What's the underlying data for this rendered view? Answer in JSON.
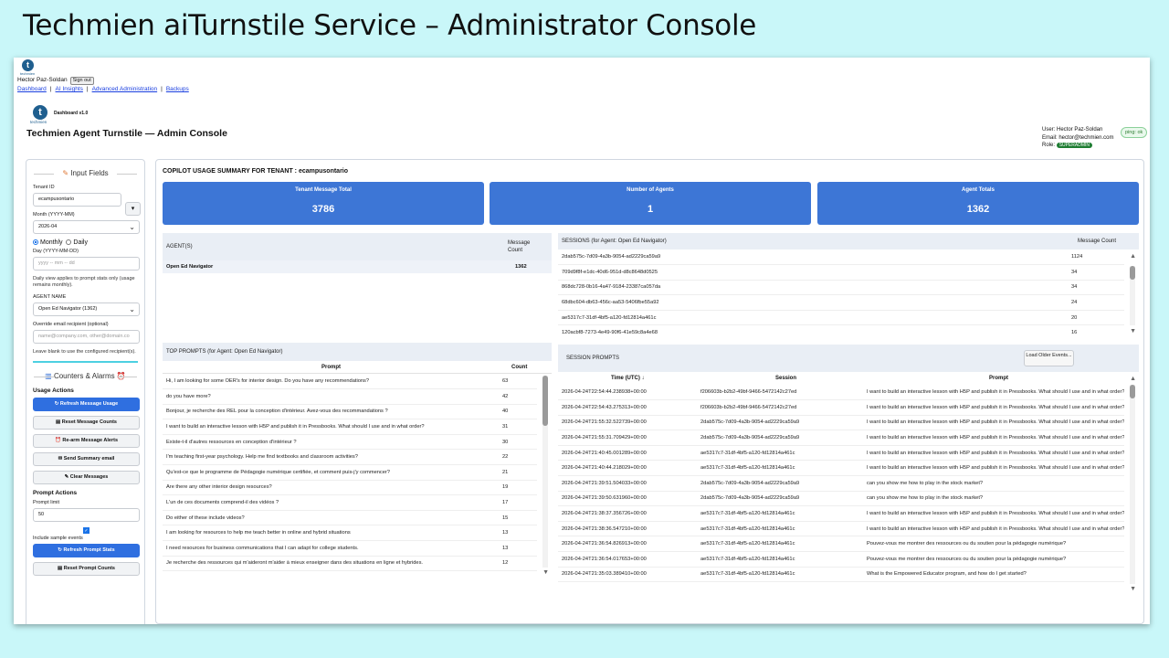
{
  "slide": {
    "title": "Techmien aiTurnstile Service – Administrator Console"
  },
  "topbar": {
    "logo_text": "techmien",
    "user_name": "Hector Paz-Soldan",
    "sign_out": "Sign out",
    "nav": [
      "Dashboard",
      "AI Insights",
      "Advanced Administration",
      "Backups"
    ]
  },
  "header": {
    "logo_text": "techmien",
    "version": "Dashboard v1.0",
    "title": "Techmien Agent Turnstile — Admin Console",
    "user": "User: Hector Paz-Soldan",
    "email": "Email: hector@techmien.com",
    "role_label": "Role:",
    "role": "SUPERADMIN",
    "ping": "ping: ok"
  },
  "sidebar": {
    "input_title": "Input Fields",
    "tenant_label": "Tenant ID",
    "tenant_value": "ecampusontario",
    "month_label": "Month (YYYY-MM)",
    "month_value": "2026-04",
    "monthly": "Monthly",
    "daily": "Daily",
    "day_label": "Day (YYYY-MM-DD)",
    "day_placeholder": "yyyy -- mm -- dd",
    "day_note": "Daily view applies to prompt stats only (usage remains monthly).",
    "agent_label": "AGENT NAME",
    "agent_value": "Open Ed Navigator (1362)",
    "email_label": "Override email recipient (optional)",
    "email_placeholder": "name@company.com, other@domain.co",
    "email_note": "Leave blank to use the configured recipient(s).",
    "counters_title": "Counters & Alarms",
    "usage_actions": "Usage Actions",
    "buttons": [
      "Refresh Message Usage",
      "Reset Message Counts",
      "Re-arm Message Alerts",
      "Send Summary email",
      "Clear Messages"
    ],
    "prompt_actions": "Prompt Actions",
    "prompt_limit_label": "Prompt limit",
    "prompt_limit_value": "50",
    "include_sample": "Include sample events",
    "prompt_buttons": [
      "Refresh Prompt Stats",
      "Reset Prompt Counts"
    ]
  },
  "main": {
    "summary_title": "COPILOT USAGE SUMMARY FOR TENANT : ecampusontario",
    "kpis": [
      {
        "label": "Tenant Message Total",
        "value": "3786"
      },
      {
        "label": "Number of Agents",
        "value": "1"
      },
      {
        "label": "Agent Totals",
        "value": "1362"
      }
    ],
    "agents": {
      "col1": "AGENT(S)",
      "col2": "Message Count",
      "rows": [
        {
          "name": "Open Ed Navigator",
          "count": "1362"
        }
      ]
    },
    "sessions": {
      "title": "SESSIONS (for Agent: Open Ed Navigator)",
      "count_header": "Message Count",
      "rows": [
        {
          "id": "2dab575c-7d09-4a3b-9054-ad2229ca59a9",
          "count": "1124"
        },
        {
          "id": "709d9f8f-e1dc-40d6-951d-d8c8648d0525",
          "count": "34"
        },
        {
          "id": "868dc728-0b16-4a47-9184-23387ca057da",
          "count": "34"
        },
        {
          "id": "68dbc604-db63-456c-aa53-5406fbe55a92",
          "count": "24"
        },
        {
          "id": "ae5317c7-31df-4bf5-a120-fd12814a461c",
          "count": "20"
        },
        {
          "id": "120acbf8-7273-4e49-90f6-41e59c8a4e68",
          "count": "16"
        }
      ]
    },
    "top_prompts": {
      "title": "TOP PROMPTS (for Agent: Open Ed Navigator)",
      "col_prompt": "Prompt",
      "col_count": "Count",
      "rows": [
        {
          "p": "Hi, I am looking for some OER's for interior design. Do you have any recommendations?",
          "c": "63"
        },
        {
          "p": "do you have more?",
          "c": "42"
        },
        {
          "p": "Bonjour, je recherche des REL pour la conception d'intérieur. Avez-vous des recommandations ?",
          "c": "40"
        },
        {
          "p": "I want to build an interactive lesson with H5P and publish it in Pressbooks. What should I use and in what order?",
          "c": "31"
        },
        {
          "p": "Existe-t-il d'autres ressources en conception d'intérieur ?",
          "c": "30"
        },
        {
          "p": "I'm teaching first-year psychology. Help me find textbooks and classroom activities?",
          "c": "22"
        },
        {
          "p": "Qu'est-ce que le programme de Pédagogie numérique certifiée, et comment puis-j'y commencer?",
          "c": "21"
        },
        {
          "p": "Are there any other interior design resources?",
          "c": "19"
        },
        {
          "p": "L'un de ces documents comprend-il des vidéos ?",
          "c": "17"
        },
        {
          "p": "Do either of these include videos?",
          "c": "15"
        },
        {
          "p": "I am looking for resources to help me teach better in online and hybrid situations",
          "c": "13"
        },
        {
          "p": "I need resources for business communications that I can adapt for college students.",
          "c": "13"
        },
        {
          "p": "Je recherche des ressources qui m'aideront m'aider à mieux enseigner dans des situations en ligne et hybrides.",
          "c": "12"
        }
      ]
    },
    "session_prompts": {
      "title": "SESSION PROMPTS",
      "load_older": "Load Older Events...",
      "col_time": "Time (UTC) ↓",
      "col_session": "Session",
      "col_prompt": "Prompt",
      "rows": [
        {
          "t": "2026-04-24T22:54:44.238938+00:00",
          "s": "f206603b-b2b2-49bf-9466-5472142c27ed",
          "p": "I want to build an interactive lesson with H5P and publish it in Pressbooks. What should I use and in what order?"
        },
        {
          "t": "2026-04-24T22:54:43.275313+00:00",
          "s": "f206603b-b2b2-49bf-9466-5472142c27ed",
          "p": "I want to build an interactive lesson with H5P and publish it in Pressbooks. What should I use and in what order?"
        },
        {
          "t": "2026-04-24T21:55:32.522739+00:00",
          "s": "2dab575c-7d09-4a3b-9054-ad2229ca59a9",
          "p": "I want to build an interactive lesson with H5P and publish it in Pressbooks. What should I use and in what order?"
        },
        {
          "t": "2026-04-24T21:55:31.709429+00:00",
          "s": "2dab575c-7d09-4a3b-9054-ad2229ca59a9",
          "p": "I want to build an interactive lesson with H5P and publish it in Pressbooks. What should I use and in what order?"
        },
        {
          "t": "2026-04-24T21:40:45.001289+00:00",
          "s": "ae5317c7-31df-4bf5-a120-fd12814a461c",
          "p": "I want to build an interactive lesson with H5P and publish it in Pressbooks. What should I use and in what order?"
        },
        {
          "t": "2026-04-24T21:40:44.218029+00:00",
          "s": "ae5317c7-31df-4bf5-a120-fd12814a461c",
          "p": "I want to build an interactive lesson with H5P and publish it in Pressbooks. What should I use and in what order?"
        },
        {
          "t": "2026-04-24T21:39:51.504033+00:00",
          "s": "2dab575c-7d09-4a3b-9054-ad2229ca59a9",
          "p": "can you show me how to play in the stock market?"
        },
        {
          "t": "2026-04-24T21:39:50.631960+00:00",
          "s": "2dab575c-7d09-4a3b-9054-ad2229ca59a9",
          "p": "can you show me how to play in the stock market?"
        },
        {
          "t": "2026-04-24T21:38:37.356726+00:00",
          "s": "ae5317c7-31df-4bf5-a120-fd12814a461c",
          "p": "I want to build an interactive lesson with H5P and publish it in Pressbooks. What should I use and in what order?"
        },
        {
          "t": "2026-04-24T21:38:36.547210+00:00",
          "s": "ae5317c7-31df-4bf5-a120-fd12814a461c",
          "p": "I want to build an interactive lesson with H5P and publish it in Pressbooks. What should I use and in what order?"
        },
        {
          "t": "2026-04-24T21:36:54.826913+00:00",
          "s": "ae5317c7-31df-4bf5-a120-fd12814a461c",
          "p": "Pouvez-vous me montrer des ressources ou du soutien pour la pédagogie numérique?"
        },
        {
          "t": "2026-04-24T21:36:54.017653+00:00",
          "s": "ae5317c7-31df-4bf5-a120-fd12814a461c",
          "p": "Pouvez-vous me montrer des ressources ou du soutien pour la pédagogie numérique?"
        },
        {
          "t": "2026-04-24T21:35:03.389410+00:00",
          "s": "ae5317c7-31df-4bf5-a120-fd12814a461c",
          "p": "What is the Empowered Educator program, and how do I get started?"
        }
      ]
    }
  }
}
